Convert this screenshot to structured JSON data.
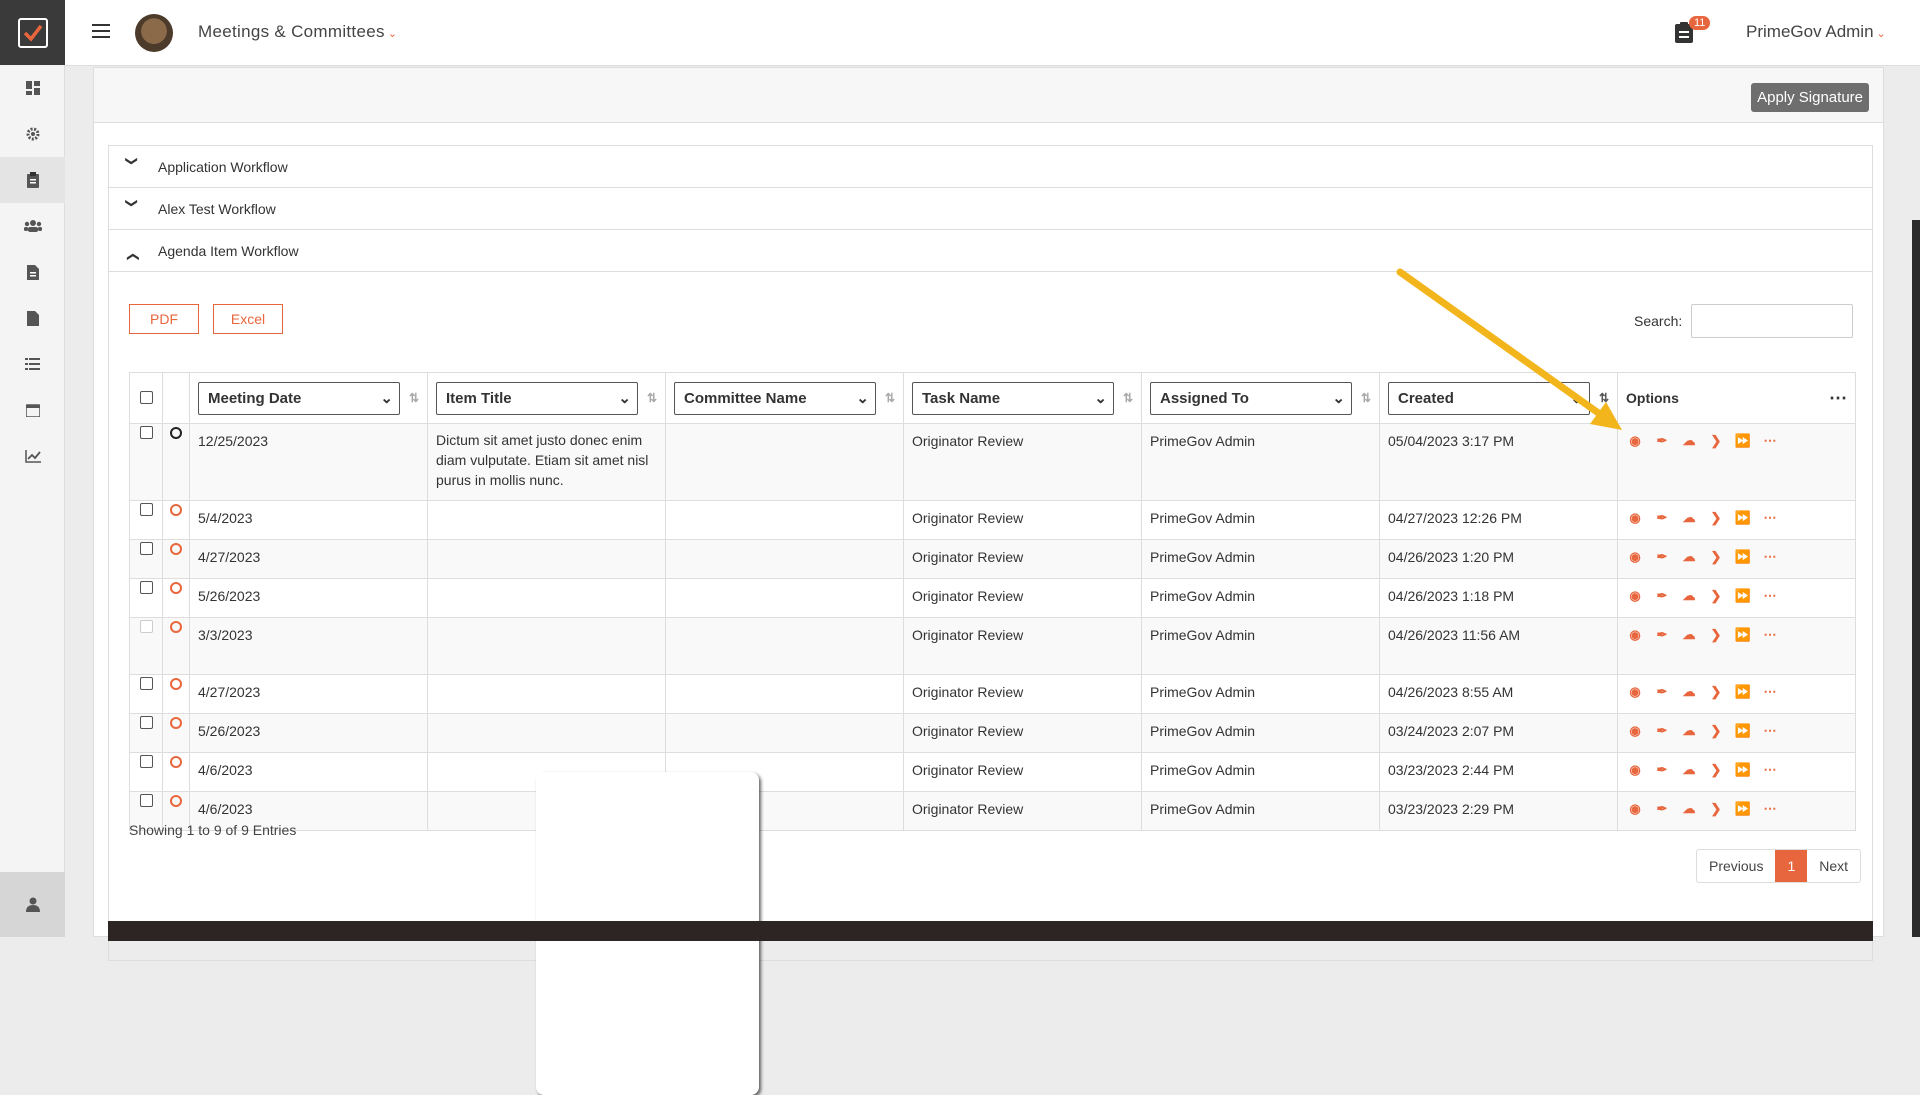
{
  "header": {
    "module_title": "Meetings & Committees",
    "notification_count": "11",
    "user_name": "PrimeGov Admin"
  },
  "toolbar": {
    "apply_signature": "Apply Signature"
  },
  "workflows": [
    {
      "label": "Application Workflow",
      "expanded": false
    },
    {
      "label": "Alex Test Workflow",
      "expanded": false
    },
    {
      "label": "Agenda Item Workflow",
      "expanded": true
    }
  ],
  "export": {
    "pdf": "PDF",
    "excel": "Excel"
  },
  "search": {
    "label": "Search:",
    "value": ""
  },
  "columns": {
    "meeting_date": "Meeting Date",
    "item_title": "Item Title",
    "committee_name": "Committee Name",
    "task_name": "Task Name",
    "assigned_to": "Assigned To",
    "created": "Created",
    "options": "Options"
  },
  "rows": [
    {
      "meeting_date": "12/25/2023",
      "item_title": "Dictum sit amet justo donec enim diam vulputate. Etiam sit amet nisl purus in mollis nunc.",
      "committee": "",
      "task": "Originator Review",
      "assigned": "PrimeGov Admin",
      "created": "05/04/2023 3:17 PM"
    },
    {
      "meeting_date": "5/4/2023",
      "item_title": "",
      "committee": "",
      "task": "Originator Review",
      "assigned": "PrimeGov Admin",
      "created": "04/27/2023 12:26 PM"
    },
    {
      "meeting_date": "4/27/2023",
      "item_title": "",
      "committee": "",
      "task": "Originator Review",
      "assigned": "PrimeGov Admin",
      "created": "04/26/2023 1:20 PM"
    },
    {
      "meeting_date": "5/26/2023",
      "item_title": "",
      "committee": "",
      "task": "Originator Review",
      "assigned": "PrimeGov Admin",
      "created": "04/26/2023 1:18 PM"
    },
    {
      "meeting_date": "3/3/2023",
      "item_title": "",
      "committee": "",
      "task": "Originator Review",
      "assigned": "PrimeGov Admin",
      "created": "04/26/2023 11:56 AM"
    },
    {
      "meeting_date": "4/27/2023",
      "item_title": "",
      "committee": "",
      "task": "Originator Review",
      "assigned": "PrimeGov Admin",
      "created": "04/26/2023 8:55 AM"
    },
    {
      "meeting_date": "5/26/2023",
      "item_title": "",
      "committee": "",
      "task": "Originator Review",
      "assigned": "PrimeGov Admin",
      "created": "03/24/2023 2:07 PM"
    },
    {
      "meeting_date": "4/6/2023",
      "item_title": "",
      "committee": "",
      "task": "Originator Review",
      "assigned": "PrimeGov Admin",
      "created": "03/23/2023 2:44 PM"
    },
    {
      "meeting_date": "4/6/2023",
      "item_title": "",
      "committee": "",
      "task": "Originator Review",
      "assigned": "PrimeGov Admin",
      "created": "03/23/2023 2:29 PM"
    }
  ],
  "footer": {
    "showing": "Showing 1 to 9 of 9 Entries",
    "previous": "Previous",
    "page": "1",
    "next": "Next"
  }
}
